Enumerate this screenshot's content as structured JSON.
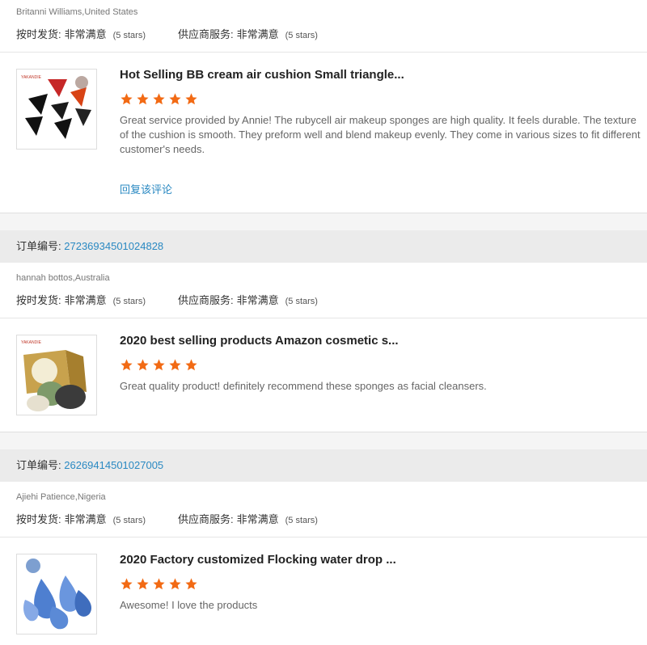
{
  "labels": {
    "ship_label": "按时发货:",
    "supplier_label": "供应商服务:",
    "very_satisfied": "非常满意",
    "five_stars": "(5 stars)",
    "order_label": "订单编号:",
    "reply": "回复该评论"
  },
  "blocks": [
    {
      "buyer": "Britanni Williams,United States",
      "product_title": "Hot Selling BB cream air cushion Small triangle...",
      "stars": 5,
      "review": "Great service provided by Annie! The rubycell air makeup sponges are high quality. It feels durable. The texture of the cushion is smooth. They preform well and blend makeup evenly. They come in various sizes to fit different customer's needs.",
      "thumb_icon": "triangle-puff-image"
    },
    {
      "order_no": "27236934501024828",
      "buyer": "hannah bottos,Australia",
      "product_title": "2020 best selling products Amazon cosmetic s...",
      "stars": 5,
      "review": "Great quality product! definitely recommend these sponges as facial cleansers.",
      "thumb_icon": "konjac-sponge-image",
      "thumb_brand": "YAKANDIE"
    },
    {
      "order_no": "26269414501027005",
      "buyer": "Ajiehi Patience,Nigeria",
      "product_title": "2020 Factory customized Flocking water drop ...",
      "stars": 5,
      "review": "Awesome! I love the products",
      "thumb_icon": "blue-sponge-image"
    }
  ],
  "first_thumb_brand": "YAKANDIE",
  "colors": {
    "star": "#f26a14",
    "link": "#2a89c2",
    "order_bar": "#ebebeb"
  }
}
